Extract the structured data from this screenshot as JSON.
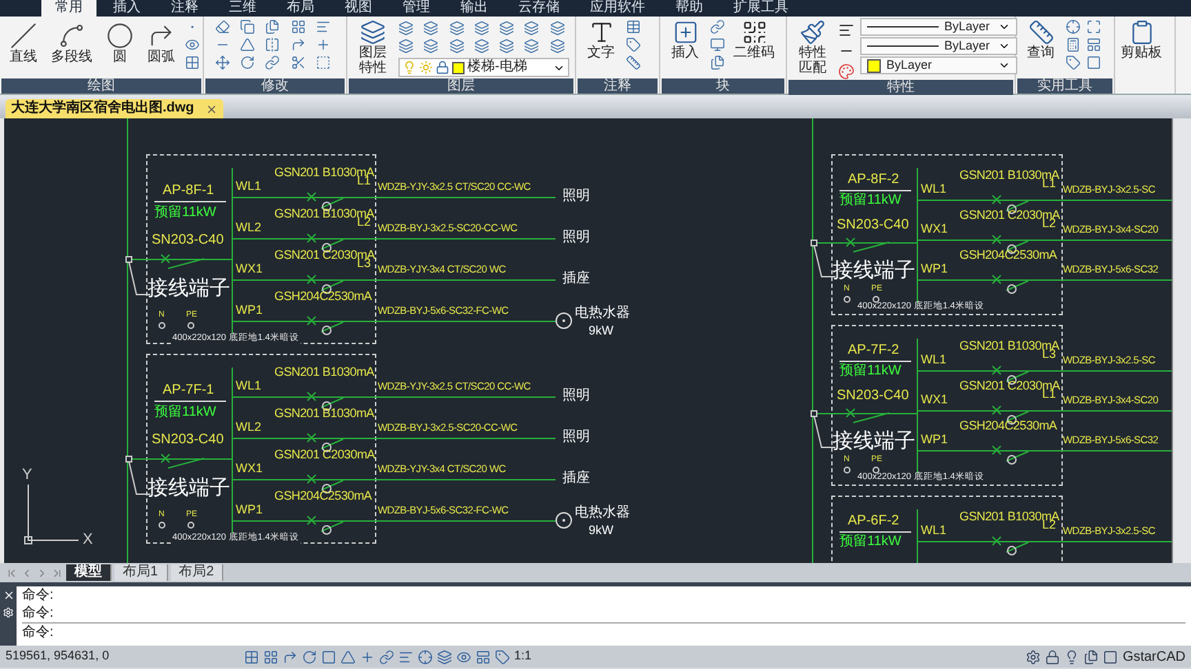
{
  "ribbon_tabs": [
    {
      "label": "常用",
      "selected": true
    },
    {
      "label": "插入",
      "selected": false
    },
    {
      "label": "注释",
      "selected": false
    },
    {
      "label": "三维",
      "selected": false
    },
    {
      "label": "布局",
      "selected": false
    },
    {
      "label": "视图",
      "selected": false
    },
    {
      "label": "管理",
      "selected": false
    },
    {
      "label": "输出",
      "selected": false
    },
    {
      "label": "云存储",
      "selected": false
    },
    {
      "label": "应用软件",
      "selected": false
    },
    {
      "label": "帮助",
      "selected": false
    },
    {
      "label": "扩展工具",
      "selected": false
    }
  ],
  "ribbon_panels": [
    {
      "kind": "draw",
      "title": "绘图",
      "tools": [
        "直线",
        "多段线",
        "圆",
        "圆弧"
      ]
    },
    {
      "kind": "modify",
      "title": "修改"
    },
    {
      "kind": "layer",
      "title": "图层",
      "tools": [
        "图层特性"
      ],
      "current_layer": "楼梯-电梯"
    },
    {
      "kind": "annotate",
      "title": "注释",
      "tools": [
        "文字"
      ]
    },
    {
      "kind": "block",
      "title": "块",
      "tools": [
        "插入",
        "二维码"
      ]
    },
    {
      "kind": "properties",
      "title": "特性",
      "tools": [
        "特性匹配"
      ],
      "lineweight": "ByLayer",
      "linetype": "ByLayer",
      "color_setting": "ByLayer"
    },
    {
      "kind": "utilities",
      "title": "实用工具",
      "tools": [
        "查询"
      ]
    },
    {
      "kind": "clipboard",
      "tools": [
        "剪贴板"
      ]
    }
  ],
  "document_tabs": [
    {
      "label": "大连大学南区宿舍电出图.dwg",
      "selected": true
    }
  ],
  "drawing": {
    "panels": [
      {
        "kind": "left",
        "name": "AP-8F-1",
        "reserve": "预留11kW",
        "main_breaker": "SN203-C40",
        "terminal": "接线端子",
        "n": "N",
        "pe": "PE",
        "note": "400x220x120 底距地1.4米暗设",
        "circuits": [
          {
            "label": "WL1",
            "breaker": "GSN201 B1030mA",
            "phase": "L1",
            "cable": "WDZB-YJY-3x2.5 CT/SC20 CC-WC",
            "load": "照明"
          },
          {
            "label": "WL2",
            "breaker": "GSN201 B1030mA",
            "phase": "L2",
            "cable": "WDZB-BYJ-3x2.5-SC20-CC-WC",
            "load": "照明"
          },
          {
            "label": "WX1",
            "breaker": "GSN201 C2030mA",
            "phase": "L3",
            "cable": "WDZB-YJY-3x4 CT/SC20 WC",
            "load": "插座"
          },
          {
            "label": "WP1",
            "breaker": "GSH204C2530mA",
            "cable": "WDZB-BYJ-5x6-SC32-FC-WC",
            "load": "电热水器",
            "rating": "9kW"
          }
        ]
      },
      {
        "kind": "left",
        "name": "AP-7F-1",
        "reserve": "预留11kW",
        "main_breaker": "SN203-C40",
        "terminal": "接线端子",
        "n": "N",
        "pe": "PE",
        "note": "400x220x120 底距地1.4米暗设",
        "circuits": [
          {
            "label": "WL1",
            "breaker": "GSN201 B1030mA",
            "cable": "WDZB-YJY-3x2.5 CT/SC20 CC-WC",
            "load": "照明"
          },
          {
            "label": "WL2",
            "breaker": "GSN201 B1030mA",
            "cable": "WDZB-BYJ-3x2.5-SC20-CC-WC",
            "load": "照明"
          },
          {
            "label": "WX1",
            "breaker": "GSN201 C2030mA",
            "cable": "WDZB-YJY-3x4 CT/SC20 WC",
            "load": "插座"
          },
          {
            "label": "WP1",
            "breaker": "GSH204C2530mA",
            "cable": "WDZB-BYJ-5x6-SC32-FC-WC",
            "load": "电热水器",
            "rating": "9kW"
          }
        ]
      },
      {
        "kind": "right",
        "name": "AP-8F-2",
        "reserve": "预留11kW",
        "main_breaker": "SN203-C40",
        "terminal": "接线端子",
        "n": "N",
        "pe": "PE",
        "note": "400x220x120 底距地1.4米暗设",
        "circuits": [
          {
            "label": "WL1",
            "breaker": "GSN201 B1030mA",
            "phase": "L1",
            "cable": "WDZB-BYJ-3x2.5-SC"
          },
          {
            "label": "WX1",
            "breaker": "GSN201 C2030mA",
            "phase": "L2",
            "cable": "WDZB-BYJ-3x4-SC20"
          },
          {
            "label": "WP1",
            "breaker": "GSH204C2530mA",
            "cable": "WDZB-BYJ-5x6-SC32"
          }
        ]
      },
      {
        "kind": "right",
        "name": "AP-7F-2",
        "reserve": "预留11kW",
        "main_breaker": "SN203-C40",
        "terminal": "接线端子",
        "n": "N",
        "pe": "PE",
        "note": "400x220x120 底距地1.4米暗设",
        "circuits": [
          {
            "label": "WL1",
            "breaker": "GSN201 B1030mA",
            "phase": "L3",
            "cable": "WDZB-BYJ-3x2.5-SC"
          },
          {
            "label": "WX1",
            "breaker": "GSN201 C2030mA",
            "phase": "L1",
            "cable": "WDZB-BYJ-3x4-SC20"
          },
          {
            "label": "WP1",
            "breaker": "GSH204C2530mA",
            "cable": "WDZB-BYJ-5x6-SC32"
          }
        ]
      },
      {
        "kind": "right",
        "name": "AP-6F-2",
        "reserve": "预留11kW",
        "circuits": [
          {
            "label": "WL1",
            "breaker": "GSN201 B1030mA",
            "phase": "L2",
            "cable": "WDZB-BYJ-3x2.5-SC"
          }
        ]
      }
    ],
    "ucs": {
      "y_axis": "Y",
      "x_axis": "X"
    }
  },
  "layout_tabs": [
    {
      "label": "模型",
      "selected": true
    },
    {
      "label": "布局1",
      "selected": false
    },
    {
      "label": "布局2",
      "selected": false
    }
  ],
  "command_lines": [
    "命令:",
    "命令:"
  ],
  "command_prompt": "命令:",
  "status_bar": {
    "coordinates": "519561, 954631, 0",
    "scale": "1:1",
    "product": "GstarCAD"
  }
}
